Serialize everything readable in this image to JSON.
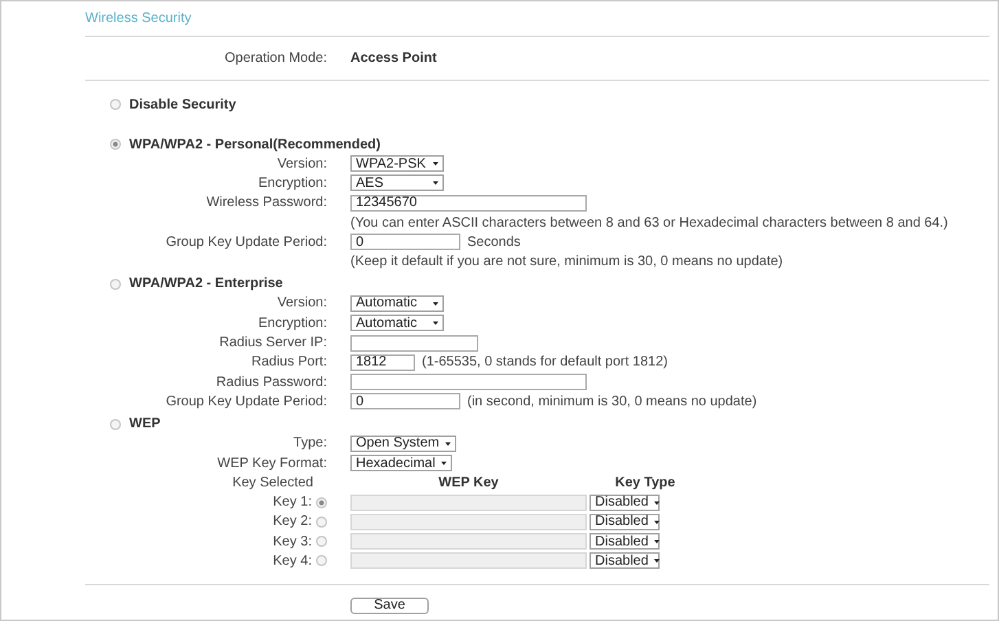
{
  "title": "Wireless Security",
  "operation_mode": {
    "label": "Operation Mode:",
    "value": "Access Point"
  },
  "sections": [
    {
      "label": "Disable Security",
      "selected": false
    },
    {
      "label": "WPA/WPA2 - Personal(Recommended)",
      "selected": true,
      "fields": [
        {
          "kind": "select",
          "label": "Version:",
          "value": "WPA2-PSK"
        },
        {
          "kind": "select",
          "label": "Encryption:",
          "value": "AES"
        },
        {
          "kind": "input",
          "label": "Wireless Password:",
          "value": "12345670"
        },
        {
          "kind": "note",
          "text": "(You can enter ASCII characters between 8 and 63 or Hexadecimal characters between 8 and 64.)"
        },
        {
          "kind": "input",
          "label": "Group Key Update Period:",
          "value": "0",
          "suffix": "Seconds"
        },
        {
          "kind": "note",
          "text": "(Keep it default if you are not sure, minimum is 30, 0 means no update)"
        }
      ]
    },
    {
      "label": "WPA/WPA2 - Enterprise",
      "selected": false,
      "fields": [
        {
          "kind": "select",
          "label": "Version:",
          "value": "Automatic"
        },
        {
          "kind": "select",
          "label": "Encryption:",
          "value": "Automatic"
        },
        {
          "kind": "input",
          "label": "Radius Server IP:"
        },
        {
          "kind": "input",
          "label": "Radius Port:",
          "value": "1812",
          "suffix": "(1-65535, 0 stands for default port 1812)"
        },
        {
          "kind": "input",
          "label": "Radius Password:"
        },
        {
          "kind": "input",
          "label": "Group Key Update Period:",
          "value": "0",
          "suffix": "(in second, minimum is 30, 0 means no update)"
        }
      ]
    },
    {
      "label": "WEP",
      "selected": false,
      "fields": [
        {
          "kind": "select",
          "label": "Type:",
          "value": "Open System"
        },
        {
          "kind": "select",
          "label": "WEP Key Format:",
          "value": "Hexadecimal"
        }
      ],
      "key_table": {
        "headers": [
          "Key Selected",
          "WEP Key",
          "Key Type"
        ],
        "keys": [
          {
            "label": "Key 1:",
            "selected": true,
            "disabled": true,
            "type": "Disabled"
          },
          {
            "label": "Key 2:",
            "selected": false,
            "disabled": true,
            "type": "Disabled"
          },
          {
            "label": "Key 3:",
            "selected": false,
            "disabled": true,
            "type": "Disabled"
          },
          {
            "label": "Key 4:",
            "selected": false,
            "disabled": true,
            "type": "Disabled"
          }
        ]
      }
    }
  ],
  "save_button": "Save"
}
